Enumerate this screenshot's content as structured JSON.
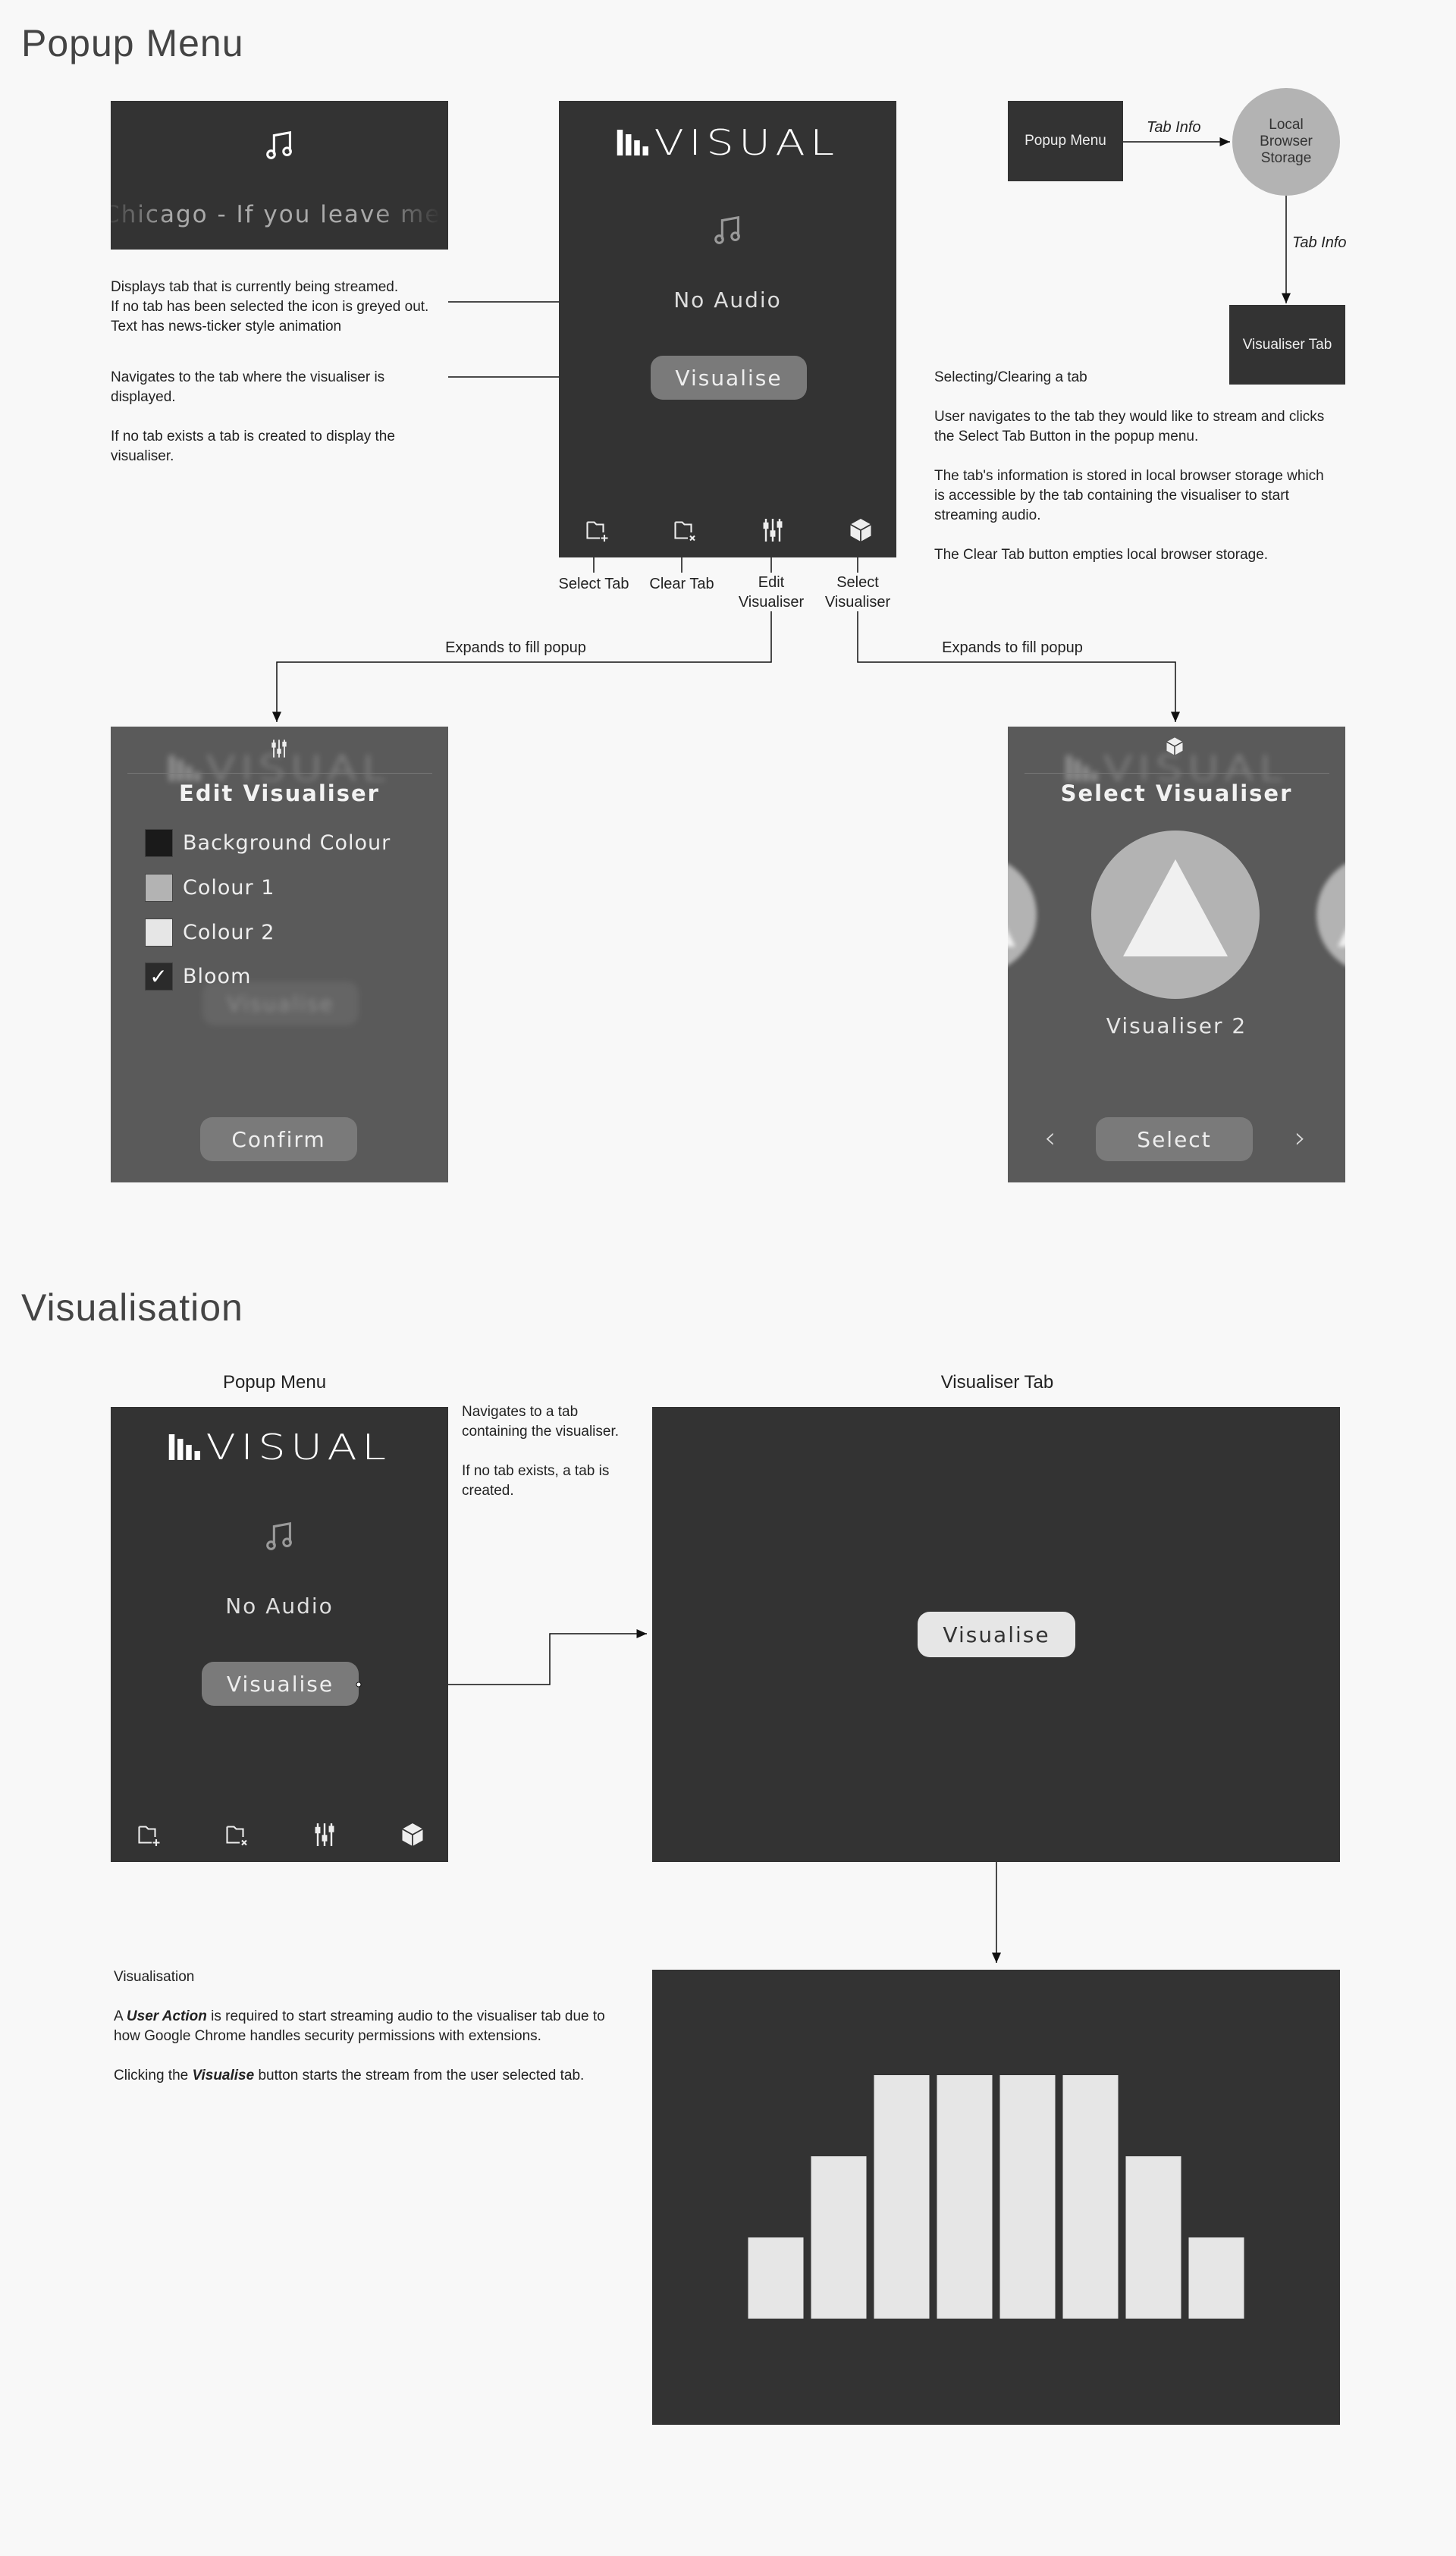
{
  "sections": {
    "popup_menu_title": "Popup Menu",
    "visualisation_title": "Visualisation"
  },
  "colors": {
    "page_bg": "#f8f8f8",
    "popup_bg": "#333333",
    "overlay_bg": "#5a5a5a",
    "button_bg": "#7a7a7a",
    "light_button_bg": "#e6e6e6",
    "circle": "#b3b3b3",
    "bar": "#e6e6e6"
  },
  "ticker": {
    "icon": "music-note-icon",
    "text": "Chicago - If you leave me"
  },
  "popup": {
    "logo": "VISUAL",
    "audio_status": "No Audio",
    "visualise_button": "Visualise",
    "toolbar": [
      {
        "icon": "folder-plus-icon",
        "label": "Select Tab"
      },
      {
        "icon": "folder-x-icon",
        "label": "Clear Tab"
      },
      {
        "icon": "sliders-icon",
        "label_lines": [
          "Edit",
          "Visualiser"
        ]
      },
      {
        "icon": "cube-icon",
        "label_lines": [
          "Select",
          "Visualiser"
        ]
      }
    ]
  },
  "annotations": {
    "ticker_note": [
      "Displays tab that is currently being streamed.",
      "If no tab has been selected the icon is greyed out.",
      "Text has news-ticker style animation"
    ],
    "visualise_note_1": "Navigates to the tab where the visualiser is displayed.",
    "visualise_note_2": "If no tab exists a tab is created to display the visualiser.",
    "expands_left": "Expands to fill popup",
    "expands_right": "Expands to fill popup"
  },
  "flow": {
    "popup_menu": "Popup Menu",
    "storage": "Local Browser Storage",
    "visualiser_tab": "Visualiser Tab",
    "edge_1": "Tab Info",
    "edge_2": "Tab Info"
  },
  "selecting_note": {
    "title": "Selecting/Clearing a tab",
    "p1": "User navigates to the tab they would like to stream and clicks the Select Tab Button in the popup menu.",
    "p2": "The tab's information is stored in local browser storage which is accessible by the tab containing the visualiser to start streaming audio.",
    "p3": "The Clear Tab button empties local browser storage."
  },
  "edit_visualiser": {
    "title": "Edit Visualiser",
    "options": [
      {
        "label": "Background Colour",
        "color": "#1a1a1a"
      },
      {
        "label": "Colour 1",
        "color": "#b3b3b3"
      },
      {
        "label": "Colour 2",
        "color": "#e6e6e6"
      },
      {
        "label": "Bloom",
        "checked": true
      }
    ],
    "confirm": "Confirm"
  },
  "select_visualiser": {
    "title": "Select Visualiser",
    "current": "Visualiser 2",
    "select": "Select",
    "prev_icon": "chevron-left-icon",
    "next_icon": "chevron-right-icon"
  },
  "visualisation": {
    "popup_label": "Popup Menu",
    "tab_label": "Visualiser Tab",
    "nav_note_1": "Navigates to a tab containing the visualiser.",
    "nav_note_2": "If no tab exists, a tab is created.",
    "tab_button": "Visualise",
    "note_title": "Visualisation",
    "note_p1": [
      "A ",
      "User Action",
      " is required to start streaming audio to the visualiser tab due to how Google Chrome handles security permissions with extensions."
    ],
    "note_p2": [
      "Clicking the ",
      "Visualise",
      " button starts the stream from the user selected tab."
    ],
    "bar_levels": [
      1,
      2,
      3,
      3,
      3,
      3,
      2,
      1
    ]
  }
}
